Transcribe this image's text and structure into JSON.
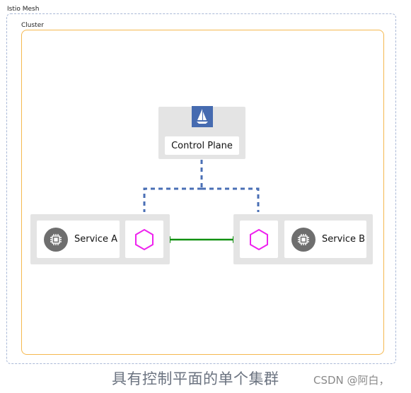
{
  "mesh": {
    "label": "Istio Mesh"
  },
  "cluster": {
    "label": "Cluster"
  },
  "control_plane": {
    "label": "Control Plane",
    "icon": "istio-sail-icon"
  },
  "services": [
    {
      "label": "Service A",
      "icon": "cpu-chip-icon",
      "proxy_icon": "hexagon-envoy-icon"
    },
    {
      "label": "Service B",
      "icon": "cpu-chip-icon",
      "proxy_icon": "hexagon-envoy-icon"
    }
  ],
  "colors": {
    "mesh_border": "#a9b8d6",
    "cluster_border": "#f5b84f",
    "control_link": "#4a6fb5",
    "data_link": "#109010",
    "proxy": "#ee22ee",
    "istio_blue": "#466bb0"
  },
  "caption": "具有控制平面的单个集群",
  "watermark": "CSDN @阿白，"
}
